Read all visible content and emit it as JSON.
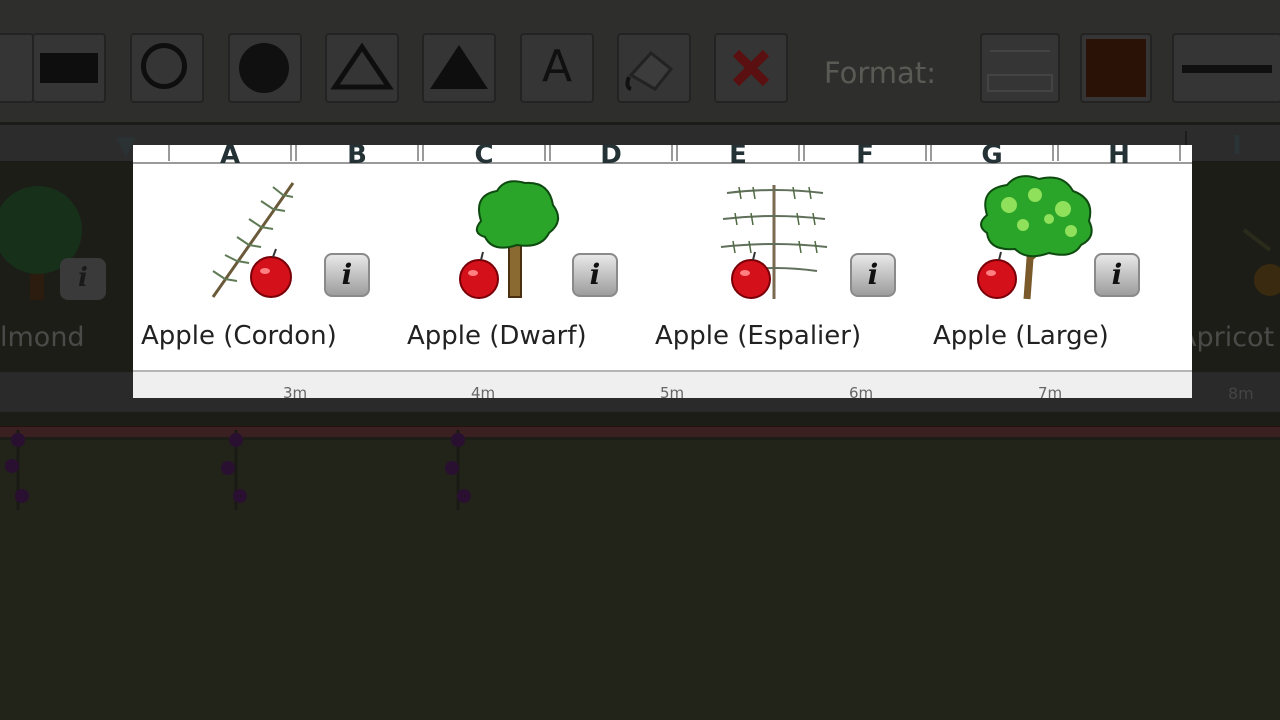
{
  "toolbar": {
    "format_label": "Format:",
    "tools": [
      "rectangle-tool",
      "filled-rectangle-tool",
      "circle-tool",
      "filled-circle-tool",
      "triangle-tool",
      "filled-triangle-tool",
      "text-tool",
      "paint-bucket-tool",
      "delete-tool"
    ],
    "fill_color": "#3a1a08"
  },
  "columns": {
    "background": [
      "A",
      "B",
      "C",
      "D",
      "E",
      "F",
      "G",
      "H",
      "I"
    ],
    "highlighted": [
      "A",
      "B",
      "C",
      "D",
      "E",
      "F",
      "G",
      "H"
    ]
  },
  "plants": [
    {
      "name": "Apple (Cordon)",
      "icon": "apple-cordon-icon"
    },
    {
      "name": "Apple (Dwarf)",
      "icon": "apple-dwarf-icon"
    },
    {
      "name": "Apple (Espalier)",
      "icon": "apple-espalier-icon"
    },
    {
      "name": "Apple (Large)",
      "icon": "apple-large-icon"
    }
  ],
  "partial_plants": {
    "left": "lmond",
    "right": "Apricot"
  },
  "ruler": {
    "labels": [
      "3m",
      "4m",
      "5m",
      "6m",
      "7m",
      "8m"
    ]
  },
  "colors": {
    "tree_green": "#2aa52a",
    "apple_red": "#d4101a",
    "header_text": "#243236"
  }
}
